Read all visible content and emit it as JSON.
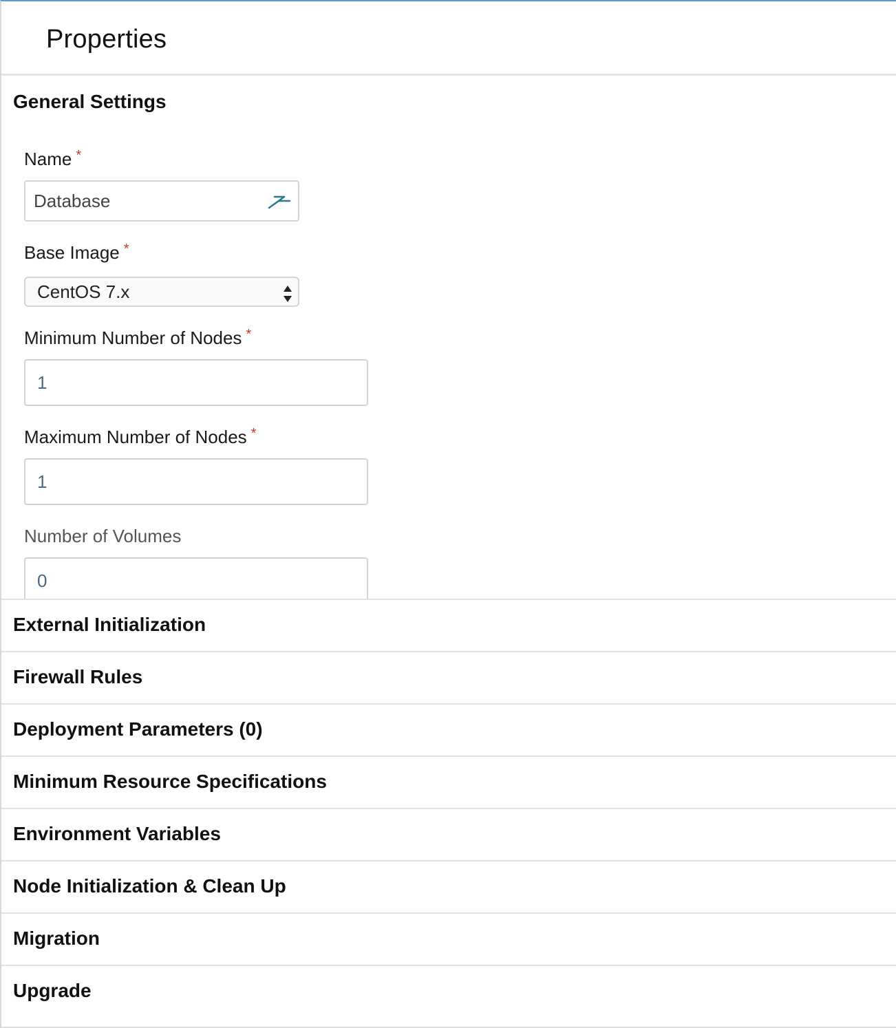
{
  "panel": {
    "title": "Properties"
  },
  "general": {
    "title": "General Settings",
    "name": {
      "label": "Name",
      "required_mark": "*",
      "value": "Database",
      "icon": "macro-icon"
    },
    "base_image": {
      "label": "Base Image",
      "required_mark": "*",
      "value": "CentOS 7.x"
    },
    "min_nodes": {
      "label": "Minimum Number of Nodes",
      "required_mark": "*",
      "value": "1"
    },
    "max_nodes": {
      "label": "Maximum Number of Nodes",
      "required_mark": "*",
      "value": "1"
    },
    "volumes": {
      "label": "Number of Volumes",
      "value": "0"
    }
  },
  "sections": [
    {
      "label": "External Initialization"
    },
    {
      "label": "Firewall Rules"
    },
    {
      "label": "Deployment Parameters (0)"
    },
    {
      "label": "Minimum Resource Specifications"
    },
    {
      "label": "Environment Variables"
    },
    {
      "label": "Node Initialization & Clean Up"
    },
    {
      "label": "Migration"
    },
    {
      "label": "Upgrade"
    }
  ],
  "colors": {
    "accent_top": "#5b9bd5",
    "required": "#c0392b",
    "icon": "#2a7a8c"
  }
}
